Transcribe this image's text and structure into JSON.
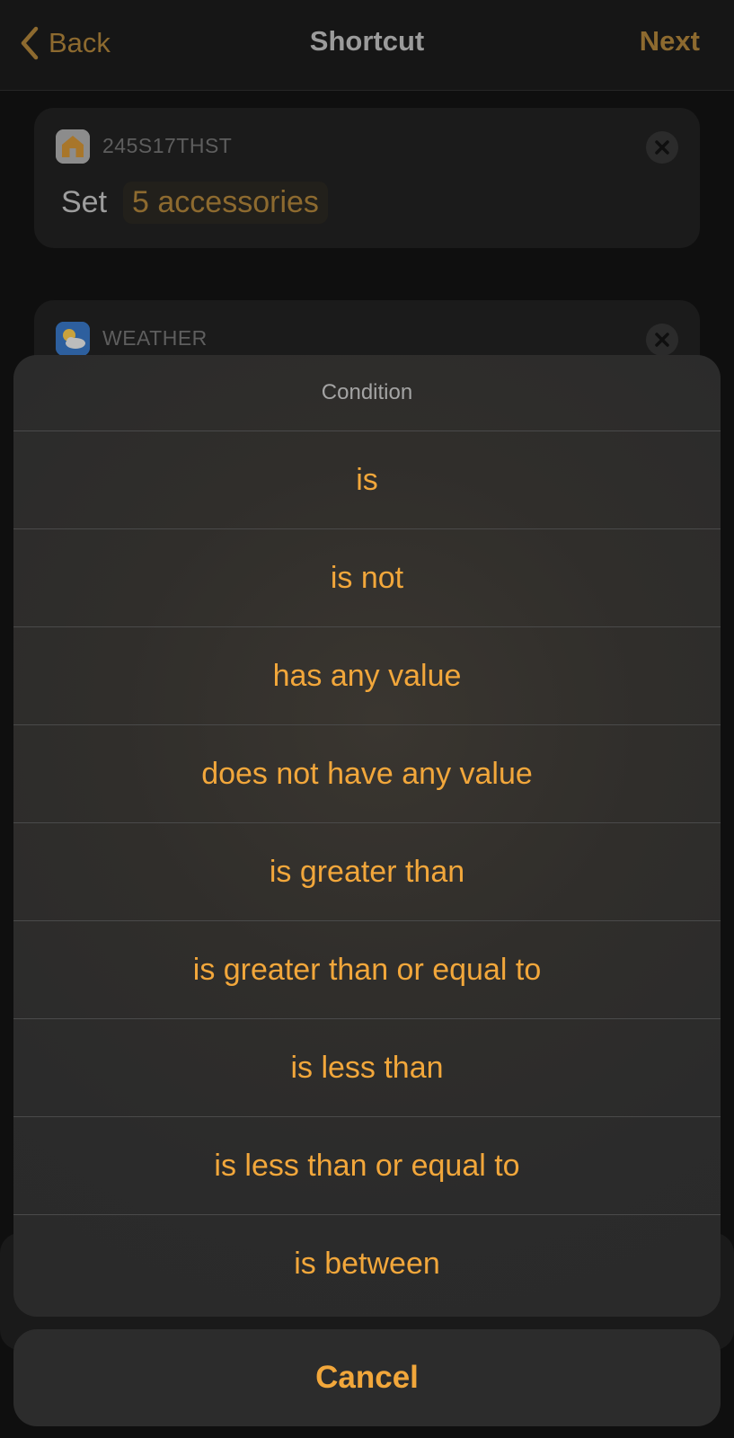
{
  "nav": {
    "back_label": "Back",
    "title": "Shortcut",
    "next_label": "Next"
  },
  "cards": {
    "home": {
      "app_label": "245S17THST",
      "verb": "Set",
      "token": "5 accessories"
    },
    "weather": {
      "app_label": "WEATHER"
    }
  },
  "sheet": {
    "title": "Condition",
    "options": [
      "is",
      "is not",
      "has any value",
      "does not have any value",
      "is greater than",
      "is greater than or equal to",
      "is less than",
      "is less than or equal to",
      "is between"
    ],
    "cancel_label": "Cancel"
  },
  "colors": {
    "accent": "#f2a73b",
    "accent_dimmed": "#8d6a2f",
    "sheet_background": "#2c2c2c",
    "page_background": "#0f0f0f"
  },
  "icons": {
    "back": "chevron-left-icon",
    "home_app": "home-app-icon",
    "weather_app": "weather-app-icon",
    "remove": "close-icon"
  }
}
